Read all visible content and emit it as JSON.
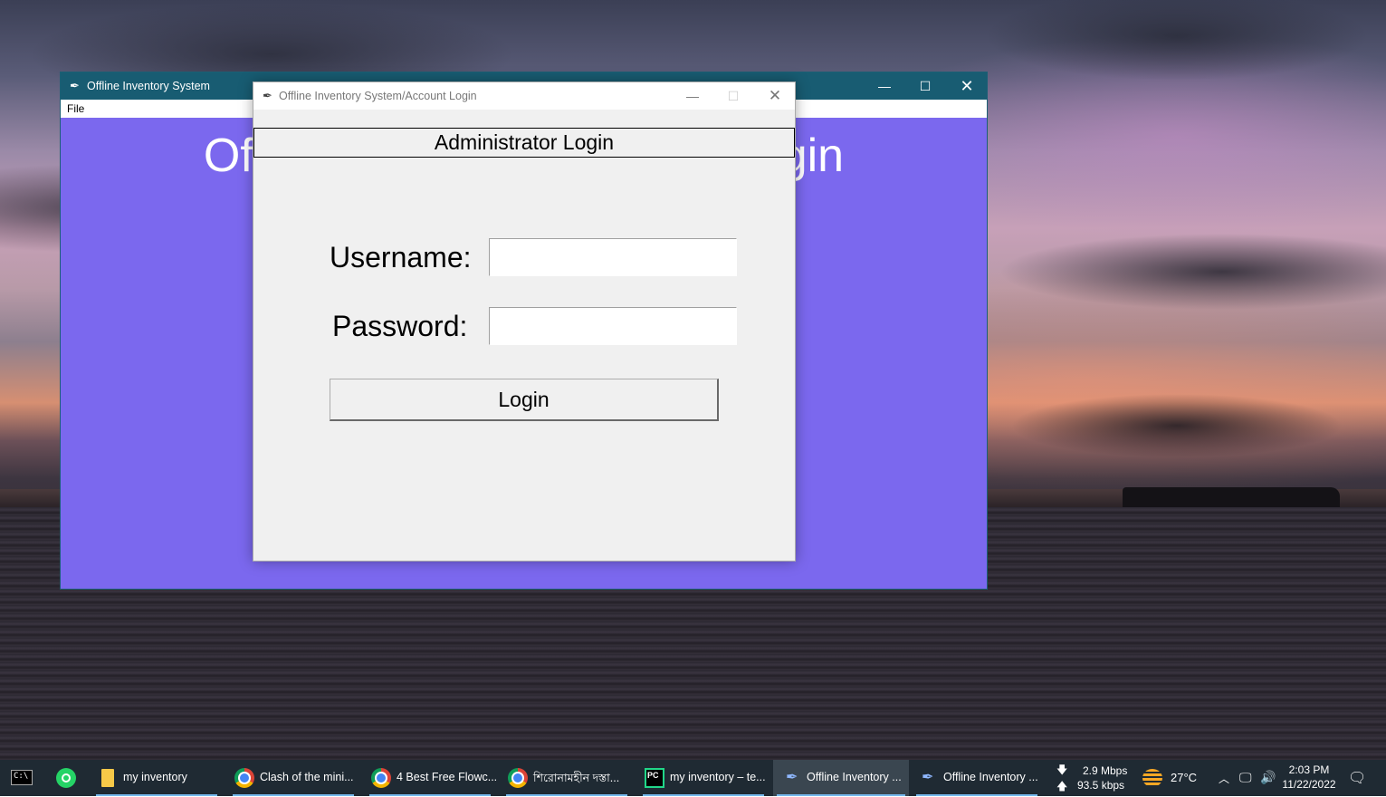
{
  "main_window": {
    "title": "Offline Inventory System",
    "menu": [
      "File"
    ],
    "background_heading": "Offline Inventory System Login",
    "bg_color": "#7b68ee"
  },
  "dialog": {
    "title": "Offline Inventory System/Account Login",
    "header": "Administrator Login",
    "username_label": "Username:",
    "username_value": "",
    "password_label": "Password:",
    "password_value": "",
    "login_button": "Login"
  },
  "icons": {
    "window_app": "feather-icon",
    "minimize": "minimize-icon",
    "maximize": "maximize-icon",
    "close": "close-icon"
  },
  "taskbar": {
    "items": [
      {
        "label": "",
        "icon": "terminal-icon"
      },
      {
        "label": "",
        "icon": "whatsapp-icon"
      },
      {
        "label": "my inventory",
        "icon": "folder-icon"
      },
      {
        "label": "Clash of the mini...",
        "icon": "chrome-icon"
      },
      {
        "label": "4 Best Free Flowc...",
        "icon": "chrome-icon"
      },
      {
        "label": "শিরোনামহীন দস্তা...",
        "icon": "chrome-icon"
      },
      {
        "label": "my inventory – te...",
        "icon": "pycharm-icon"
      },
      {
        "label": "Offline Inventory ...",
        "icon": "feather-icon"
      },
      {
        "label": "Offline Inventory ...",
        "icon": "feather-icon"
      }
    ],
    "network": {
      "download": "2.9 Mbps",
      "upload": "93.5 kbps"
    },
    "weather": "27°C",
    "time": "2:03 PM",
    "date": "11/22/2022"
  }
}
